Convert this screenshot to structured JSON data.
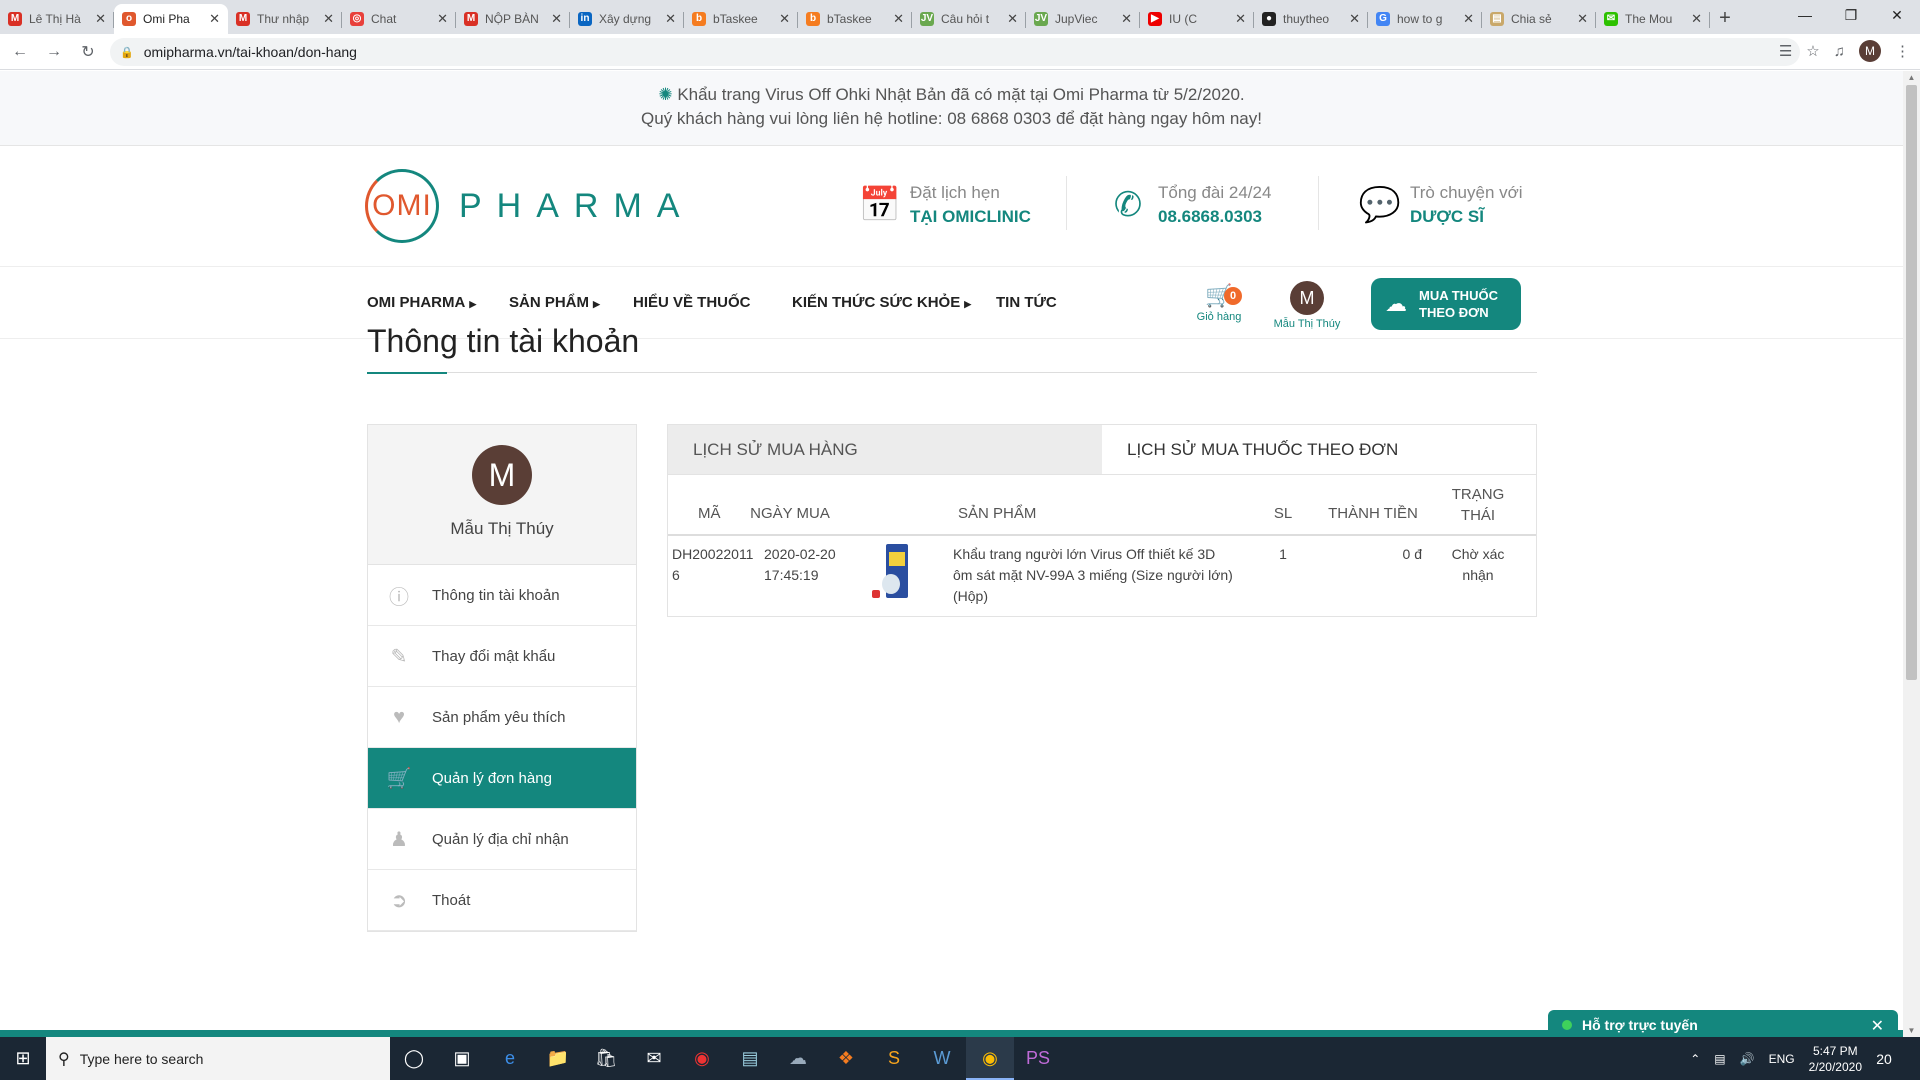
{
  "browser": {
    "tabs": [
      {
        "title": "Lê Thị Hà",
        "icon": "gmail-icon",
        "color": "#d93025",
        "glyph": "M"
      },
      {
        "title": "Omi Pha",
        "icon": "omi-icon",
        "color": "#e0582e",
        "glyph": "o",
        "active": true
      },
      {
        "title": "Thư nhập",
        "icon": "gmail-icon",
        "color": "#d93025",
        "glyph": "M"
      },
      {
        "title": "Chat",
        "icon": "chat-icon",
        "color": "#e8403b",
        "glyph": "◎"
      },
      {
        "title": "NỘP BÀN",
        "icon": "gmail-icon",
        "color": "#d93025",
        "glyph": "M"
      },
      {
        "title": "Xây dựng",
        "icon": "linkedin-icon",
        "color": "#0a66c2",
        "glyph": "in"
      },
      {
        "title": "bTaskee",
        "icon": "btaskee-icon",
        "color": "#f57c20",
        "glyph": "b"
      },
      {
        "title": "bTaskee",
        "icon": "btaskee-icon",
        "color": "#f57c20",
        "glyph": "b"
      },
      {
        "title": "Câu hỏi t",
        "icon": "jv-icon",
        "color": "#6aa84f",
        "glyph": "JV"
      },
      {
        "title": "JupViec",
        "icon": "jv-icon",
        "color": "#6aa84f",
        "glyph": "JV"
      },
      {
        "title": "IU (C",
        "icon": "youtube-icon",
        "color": "#e00",
        "glyph": "▶"
      },
      {
        "title": "thuytheo",
        "icon": "github-icon",
        "color": "#222",
        "glyph": "●"
      },
      {
        "title": "how to g",
        "icon": "google-icon",
        "color": "#4285f4",
        "glyph": "G"
      },
      {
        "title": "Chia sẻ",
        "icon": "doc-icon",
        "color": "#c9a86a",
        "glyph": "▤"
      },
      {
        "title": "The Mou",
        "icon": "wechat-icon",
        "color": "#2dc100",
        "glyph": "✉"
      }
    ],
    "url": "omipharma.vn/tai-khoan/don-hang",
    "profile_initial": "M"
  },
  "notice": {
    "line1": "Khẩu trang Virus Off Ohki Nhật Bản đã có mặt tại Omi Pharma từ 5/2/2020.",
    "line2": "Quý khách hàng vui lòng liên hệ hotline: 08 6868 0303 để đặt hàng ngay hôm nay!"
  },
  "header": {
    "logo_omi": "OMI",
    "logo_pharma": "PHARMA",
    "appointment": {
      "line1": "Đặt lịch hẹn",
      "line2": "TẠI OMICLINIC"
    },
    "hotline": {
      "line1": "Tổng đài 24/24",
      "line2": "08.6868.0303"
    },
    "chat": {
      "line1": "Trò chuyện với",
      "line2": "DƯỢC SĨ"
    }
  },
  "nav": {
    "items": [
      "OMI PHARMA",
      "SẢN PHẨM",
      "HIỂU VỀ THUỐC",
      "KIẾN THỨC SỨC KHỎE",
      "TIN TỨC"
    ],
    "cart_count": "0",
    "cart_label": "Giỏ hàng",
    "user_initial": "M",
    "user_name": "Mẫu Thị Thúy",
    "buy_line1": "MUA THUỐC",
    "buy_line2": "THEO ĐƠN"
  },
  "page": {
    "title": "Thông tin tài khoản"
  },
  "sidebar": {
    "initial": "M",
    "name": "Mẫu Thị Thúy",
    "items": [
      {
        "label": "Thông tin tài khoản",
        "icon": "info-icon"
      },
      {
        "label": "Thay đổi mật khẩu",
        "icon": "edit-icon"
      },
      {
        "label": "Sản phẩm yêu thích",
        "icon": "heart-icon"
      },
      {
        "label": "Quản lý đơn hàng",
        "icon": "cart-icon",
        "active": true
      },
      {
        "label": "Quản lý địa chỉ nhận",
        "icon": "users-icon"
      },
      {
        "label": "Thoát",
        "icon": "logout-icon"
      }
    ]
  },
  "orders": {
    "tab_history": "LỊCH SỬ MUA HÀNG",
    "tab_prescription": "LỊCH SỬ MUA THUỐC THEO ĐƠN",
    "headers": {
      "code": "MÃ",
      "date": "NGÀY MUA",
      "product": "SẢN PHẨM",
      "qty": "SL",
      "total": "THÀNH TIỀN",
      "status": "TRẠNG THÁI"
    },
    "rows": [
      {
        "code": "DH200220116",
        "date": "2020-02-20 17:45:19",
        "product": "Khẩu trang người lớn Virus Off thiết kế 3D ôm sát mặt NV-99A 3 miếng (Size người lớn) (Hộp)",
        "qty": "1",
        "total": "0 đ",
        "status": "Chờ xác nhận"
      }
    ]
  },
  "chat_widget": {
    "label": "Hỗ trợ trực tuyến"
  },
  "taskbar": {
    "search_placeholder": "Type here to search",
    "lang": "ENG",
    "time": "5:47 PM",
    "date": "2/20/2020",
    "notif_count": "20"
  }
}
